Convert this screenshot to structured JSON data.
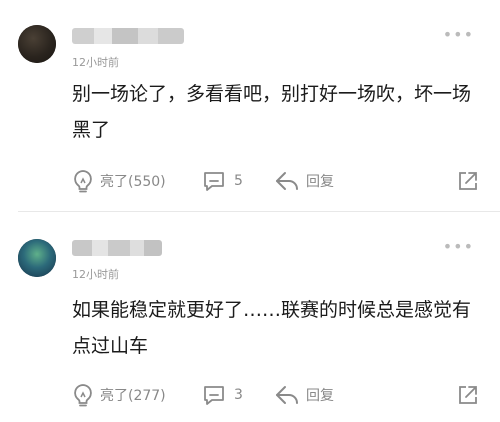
{
  "comments": [
    {
      "time": "12小时前",
      "text": "别一场论了，多看看吧，别打好一场吹，坏一场黑了",
      "like_label": "亮了(550)",
      "reply_count": "5",
      "reply_label": "回复"
    },
    {
      "time": "12小时前",
      "text": "如果能稳定就更好了……联赛的时候总是感觉有点过山车",
      "like_label": "亮了(277)",
      "reply_count": "3",
      "reply_label": "回复"
    }
  ],
  "icons": {
    "more": "more-icon",
    "like": "lightbulb-icon",
    "comment": "comment-bubble-icon",
    "reply": "reply-arrow-icon",
    "share": "share-icon"
  },
  "colors": {
    "icon_gray": "#8a8a8a",
    "text": "#1b1b1b",
    "meta": "#999999"
  }
}
